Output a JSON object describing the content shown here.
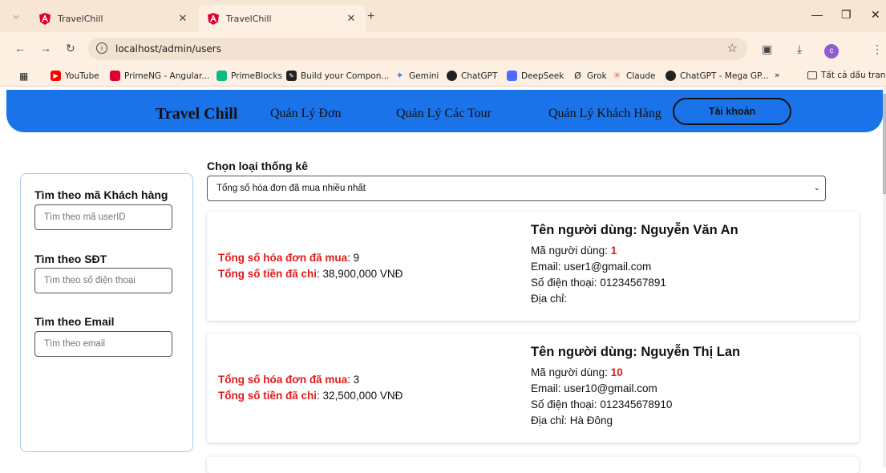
{
  "browser": {
    "tabs": [
      {
        "title": "TravelChill",
        "active": false
      },
      {
        "title": "TravelChill",
        "active": true
      }
    ],
    "url": "localhost/admin/users",
    "profile_initial": "c",
    "bookmarks": [
      {
        "label": "YouTube",
        "icon": "youtube-icon",
        "color": "#ff0000"
      },
      {
        "label": "PrimeNG - Angular...",
        "icon": "primeng-icon",
        "color": "#dd0031"
      },
      {
        "label": "PrimeBlocks",
        "icon": "primeblocks-icon",
        "color": "#10b981"
      },
      {
        "label": "Build your Compon...",
        "icon": "build-icon",
        "color": "#222222"
      },
      {
        "label": "Gemini",
        "icon": "gemini-icon",
        "color": "#4285f4"
      },
      {
        "label": "ChatGPT",
        "icon": "chatgpt-icon",
        "color": "#222222"
      },
      {
        "label": "DeepSeek",
        "icon": "deepseek-icon",
        "color": "#4d6bfe"
      },
      {
        "label": "Grok",
        "icon": "grok-icon",
        "color": "#222222"
      },
      {
        "label": "Claude",
        "icon": "claude-icon",
        "color": "#d97757"
      },
      {
        "label": "ChatGPT - Mega GP...",
        "icon": "chatgpt-icon",
        "color": "#222222"
      }
    ],
    "bookmarks_overflow": "»",
    "all_bookmarks": "Tất cả dấu trang"
  },
  "header": {
    "brand": "Travel Chill",
    "nav": [
      "Quản Lý Đơn",
      "Quản Lý Các Tour",
      "Quản Lý Khách Hàng"
    ],
    "account_button": "Tài khoản",
    "color": "#1a73e8"
  },
  "sidebar": {
    "search_id_label": "Tìm theo mã Khách hàng",
    "search_id_placeholder": "Tìm theo mã userID",
    "search_phone_label": "Tìm theo SĐT",
    "search_phone_placeholder": "Tìm theo số điện thoại",
    "search_email_label": "Tìm theo Email",
    "search_email_placeholder": "Tìm theo email"
  },
  "stats": {
    "label": "Chọn loại thống kê",
    "selected": "Tổng số hóa đơn đã mua nhiều nhất"
  },
  "labels": {
    "orders": "Tổng số hóa đơn đã mua",
    "spent": "Tổng số tiền đã chi",
    "name_prefix": "Tên người dùng: ",
    "id": "Mã người dùng: ",
    "email": "Email: ",
    "phone": "Số điện thoại: ",
    "address": "Địa chỉ:"
  },
  "customers": [
    {
      "orders": "9",
      "spent": "38,900,000 VNĐ",
      "name": "Nguyễn Văn An",
      "id": "1",
      "email": "user1@gmail.com",
      "phone": "01234567891",
      "address": ""
    },
    {
      "orders": "3",
      "spent": "32,500,000 VNĐ",
      "name": "Nguyễn Thị Lan",
      "id": "10",
      "email": "user10@gmail.com",
      "phone": "012345678910",
      "address": "Hà Đông"
    }
  ]
}
